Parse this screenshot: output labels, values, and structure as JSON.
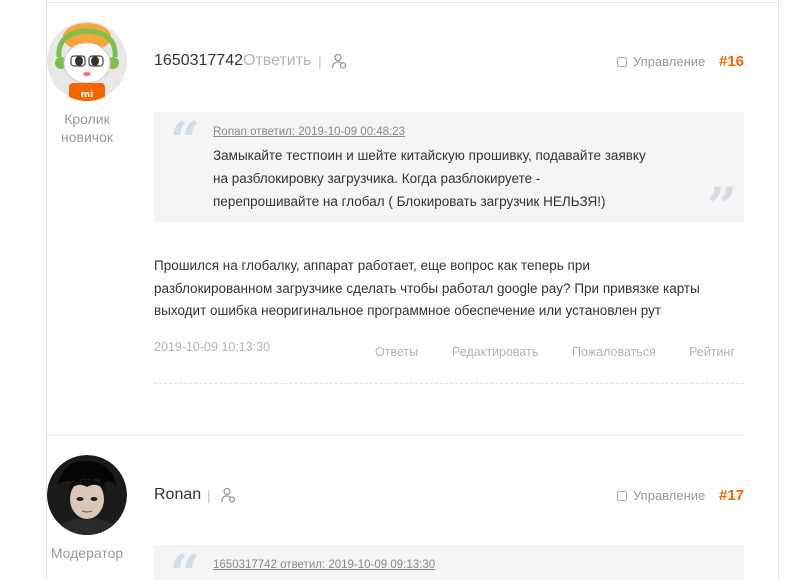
{
  "posts": [
    {
      "username": "1650317742",
      "reply_label": "Ответить",
      "rank": "Кролик новичок",
      "manage_label": "Управление",
      "floor": "#16",
      "quote": {
        "header": "Ronan ответил: 2019-10-09 00:48:23",
        "lines": [
          "Замыкайте тестпоин и шейте китайскую прошивку, подавайте заявку",
          "на разблокировку загрузчика. Когда разблокируете -",
          "перепрошивайте на глобал ( Блокировать загрузчик НЕЛЬЗЯ!)"
        ]
      },
      "body_lines": [
        "Прошился на глобалку, аппарат работает, еще вопрос как теперь при",
        "разблокированном загрузчике сделать чтобы работал google pay? При привязке карты",
        "выходит ошибка неоригинальное программное обеспечение или установлен рут"
      ],
      "time": "2019-10-09 10:13:30",
      "actions": {
        "answers": "Ответы",
        "edit": "Редактировать",
        "report": "Пожаловаться",
        "rating": "Рейтинг"
      }
    },
    {
      "username": "Ronan",
      "rank": "Модератор",
      "manage_label": "Управление",
      "floor": "#17",
      "quote": {
        "header": "1650317742 ответил: 2019-10-09 09:13:30"
      }
    }
  ],
  "icons": {
    "user": "person-icon",
    "quote": "quote-mark-icon",
    "checkbox": "checkbox-icon"
  },
  "colors": {
    "accent": "#f56600",
    "muted": "#b4b4b4",
    "quote_bg": "#f5f5f5"
  }
}
